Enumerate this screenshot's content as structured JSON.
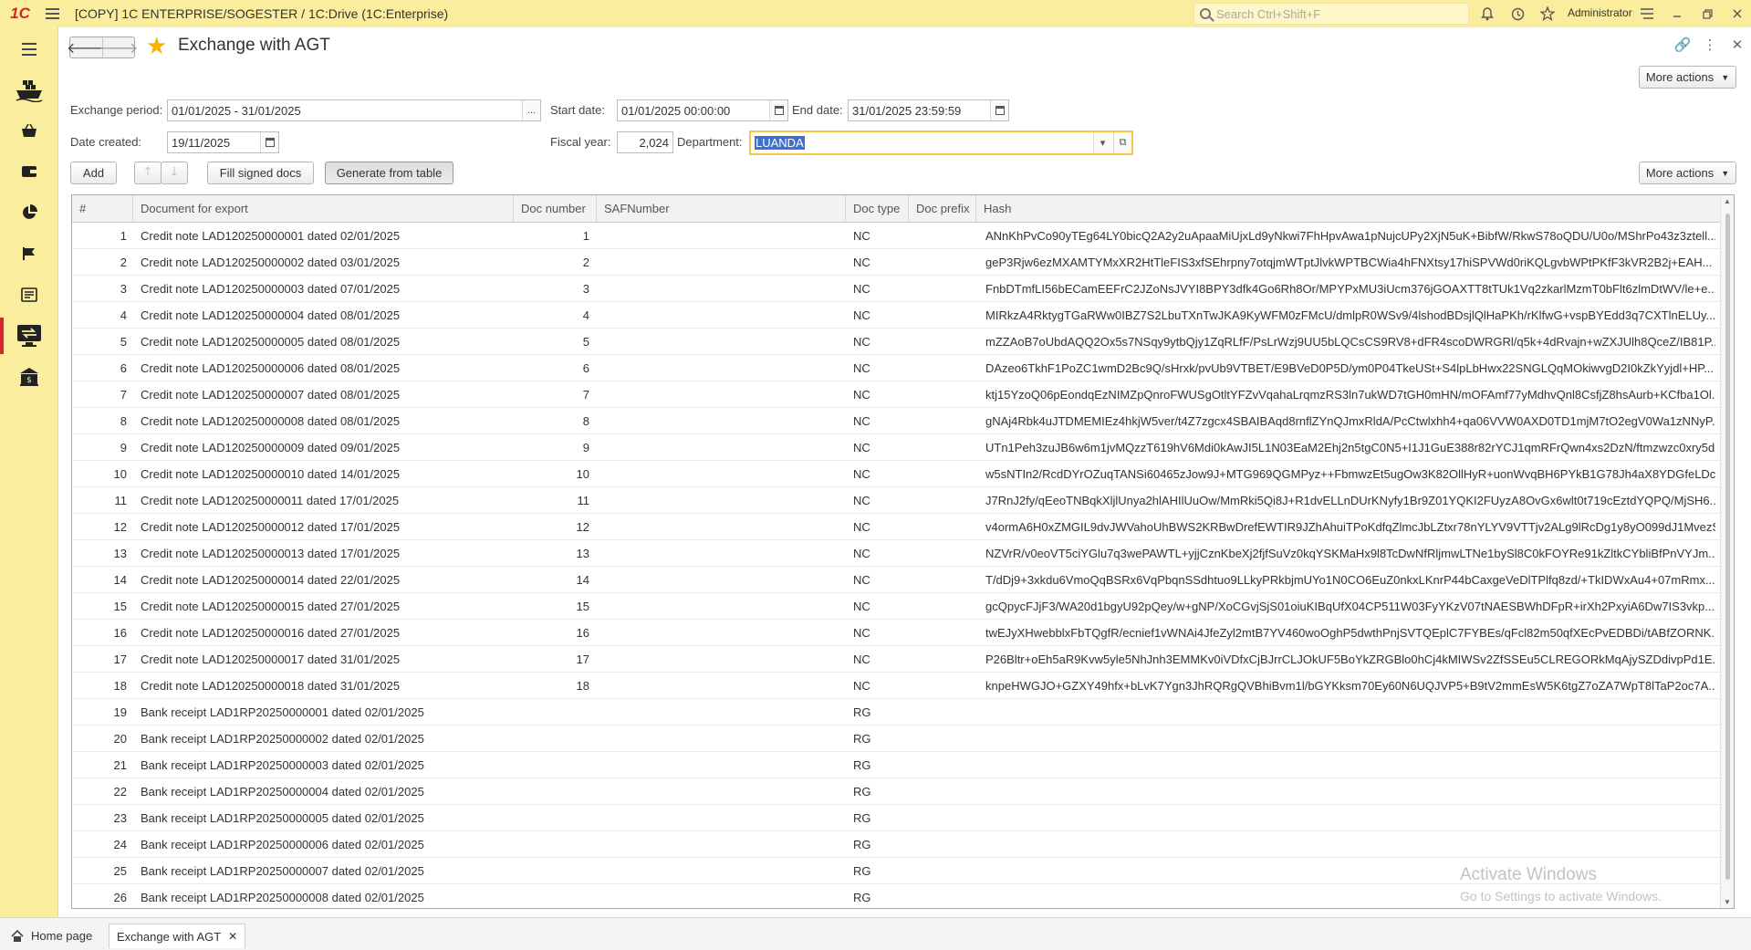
{
  "titlebar": {
    "logo": "1С",
    "title": "[COPY] 1C ENTERPRISE/SOGESTER / 1C:Drive  (1C:Enterprise)",
    "search_placeholder": "Search Ctrl+Shift+F",
    "user": "Administrator"
  },
  "form": {
    "title": "Exchange with AGT",
    "more_actions_top": "More actions",
    "more_actions_table": "More actions",
    "exchange_period_label": "Exchange period:",
    "exchange_period_value": "01/01/2025 - 31/01/2025",
    "start_date_label": "Start date:",
    "start_date_value": "01/01/2025 00:00:00",
    "end_date_label": "End date:",
    "end_date_value": "31/01/2025 23:59:59",
    "date_created_label": "Date created:",
    "date_created_value": "19/11/2025",
    "fiscal_year_label": "Fiscal year:",
    "fiscal_year_value": "2,024",
    "department_label": "Department:",
    "department_value": "LUANDA",
    "add_button": "Add",
    "fill_signed_button": "Fill signed docs",
    "generate_button": "Generate from table"
  },
  "table": {
    "columns": [
      "#",
      "Document for export",
      "Doc number",
      "SAFNumber",
      "Doc type",
      "Doc prefix",
      "Hash"
    ],
    "rows": [
      {
        "n": "1",
        "doc": "Credit note LAD120250000001 dated 02/01/2025",
        "docnum": "1",
        "saf": "",
        "type": "NC",
        "prefix": "",
        "hash": "ANnKhPvCo90yTEg64LY0bicQ2A2y2uApaaMiUjxLd9yNkwi7FhHpvAwa1pNujcUPy2XjN5uK+BibfW/RkwS78oQDU/U0o/MShrPo43z3ztell..."
      },
      {
        "n": "2",
        "doc": "Credit note LAD120250000002 dated 03/01/2025",
        "docnum": "2",
        "saf": "",
        "type": "NC",
        "prefix": "",
        "hash": "geP3Rjw6ezMXAMTYMxXR2HtTleFIS3xfSEhrpny7otqjmWTptJlvkWPTBCWia4hFNXtsy17hiSPVWd0riKQLgvbWPtPKfF3kVR2B2j+EAH..."
      },
      {
        "n": "3",
        "doc": "Credit note LAD120250000003 dated 07/01/2025",
        "docnum": "3",
        "saf": "",
        "type": "NC",
        "prefix": "",
        "hash": "FnbDTmfLI56bECamEEFrC2JZoNsJVYI8BPY3dfk4Go6Rh8Or/MPYPxMU3iUcm376jGOAXTT8tTUk1Vq2zkarlMzmT0bFlt6zlmDtWV/le+e..."
      },
      {
        "n": "4",
        "doc": "Credit note LAD120250000004 dated 08/01/2025",
        "docnum": "4",
        "saf": "",
        "type": "NC",
        "prefix": "",
        "hash": "MIRkzA4RktygTGaRWw0IBZ7S2LbuTXnTwJKA9KyWFM0zFMcU/dmlpR0WSv9/4lshodBDsjlQlHaPKh/rKlfwG+vspBYEdd3q7CXTlnELUy..."
      },
      {
        "n": "5",
        "doc": "Credit note LAD120250000005 dated 08/01/2025",
        "docnum": "5",
        "saf": "",
        "type": "NC",
        "prefix": "",
        "hash": "mZZAoB7oUbdAQQ2Ox5s7NSqy9ytbQjy1ZqRLfF/PsLrWzj9UU5bLQCsCS9RV8+dFR4scoDWRGRl/q5k+4dRvajn+wZXJUlh8QceZ/IB81P..."
      },
      {
        "n": "6",
        "doc": "Credit note LAD120250000006 dated 08/01/2025",
        "docnum": "6",
        "saf": "",
        "type": "NC",
        "prefix": "",
        "hash": "DAzeo6TkhF1PoZC1wmD2Bc9Q/sHrxk/pvUb9VTBET/E9BVeD0P5D/ym0P04TkeUSt+S4lpLbHwx22SNGLQqMOkiwvgD2I0kZkYyjdl+HP..."
      },
      {
        "n": "7",
        "doc": "Credit note LAD120250000007 dated 08/01/2025",
        "docnum": "7",
        "saf": "",
        "type": "NC",
        "prefix": "",
        "hash": "ktj15YzoQ06pEondqEzNIMZpQnroFWUSgOtltYFZvVqahaLrqmzRS3ln7ukWD7tGH0mHN/mOFAmf77yMdhvQnl8CsfjZ8hsAurb+KCfba1Ol..."
      },
      {
        "n": "8",
        "doc": "Credit note LAD120250000008 dated 08/01/2025",
        "docnum": "8",
        "saf": "",
        "type": "NC",
        "prefix": "",
        "hash": "gNAj4Rbk4uJTDMEMIEz4hkjW5ver/t4Z7zgcx4SBAIBAqd8rnflZYnQJmxRldA/PcCtwlxhh4+qa06VVW0AXD0TD1mjM7tO2egV0Wa1zNNyP..."
      },
      {
        "n": "9",
        "doc": "Credit note LAD120250000009 dated 09/01/2025",
        "docnum": "9",
        "saf": "",
        "type": "NC",
        "prefix": "",
        "hash": "UTn1Peh3zuJB6w6m1jvMQzzT619hV6Mdi0kAwJI5L1N03EaM2Ehj2n5tgC0N5+I1J1GuE388r82rYCJ1qmRFrQwn4xs2DzN/ftmzwzc0xry5d..."
      },
      {
        "n": "10",
        "doc": "Credit note LAD120250000010 dated 14/01/2025",
        "docnum": "10",
        "saf": "",
        "type": "NC",
        "prefix": "",
        "hash": "w5sNTIn2/RcdDYrOZuqTANSi60465zJow9J+MTG969QGMPyz++FbmwzEt5ugOw3K82OllHyR+uonWvqBH6PYkB1G78Jh4aX8YDGfeLDc..."
      },
      {
        "n": "11",
        "doc": "Credit note LAD120250000011 dated 17/01/2025",
        "docnum": "11",
        "saf": "",
        "type": "NC",
        "prefix": "",
        "hash": "J7RnJ2fy/qEeoTNBqkXljlUnya2hlAHIlUuOw/MmRki5Qi8J+R1dvELLnDUrKNyfy1Br9Z01YQKI2FUyzA8OvGx6wlt0t719cEztdYQPQ/MjSH6..."
      },
      {
        "n": "12",
        "doc": "Credit note LAD120250000012 dated 17/01/2025",
        "docnum": "12",
        "saf": "",
        "type": "NC",
        "prefix": "",
        "hash": "v4ormA6H0xZMGIL9dvJWVahoUhBWS2KRBwDrefEWTIR9JZhAhuiTPoKdfqZlmcJbLZtxr78nYLYV9VTTjv2ALg9lRcDg1y8yO099dJ1MvezS..."
      },
      {
        "n": "13",
        "doc": "Credit note LAD120250000013 dated 17/01/2025",
        "docnum": "13",
        "saf": "",
        "type": "NC",
        "prefix": "",
        "hash": "NZVrR/v0eoVT5ciYGlu7q3wePAWTL+yjjCznKbeXj2fjfSuVz0kqYSKMaHx9l8TcDwNfRljmwLTNe1bySl8C0kFOYRe91kZltkCYbliBfPnVYJm..."
      },
      {
        "n": "14",
        "doc": "Credit note LAD120250000014 dated 22/01/2025",
        "docnum": "14",
        "saf": "",
        "type": "NC",
        "prefix": "",
        "hash": "T/dDj9+3xkdu6VmoQqBSRx6VqPbqnSSdhtuo9LLkyPRkbjmUYo1N0CO6EuZ0nkxLKnrP44bCaxgeVeDlTPlfq8zd/+TkIDWxAu4+07mRmx..."
      },
      {
        "n": "15",
        "doc": "Credit note LAD120250000015 dated 27/01/2025",
        "docnum": "15",
        "saf": "",
        "type": "NC",
        "prefix": "",
        "hash": "gcQpycFJjF3/WA20d1bgyU92pQey/w+gNP/XoCGvjSjS01oiuKIBqUfX04CP511W03FyYKzV07tNAESBWhDFpR+irXh2PxyiA6Dw7IS3vkp..."
      },
      {
        "n": "16",
        "doc": "Credit note LAD120250000016 dated 27/01/2025",
        "docnum": "16",
        "saf": "",
        "type": "NC",
        "prefix": "",
        "hash": "twEJyXHwebblxFbTQgfR/ecnief1vWNAi4JfeZyl2mtB7YV460woOghP5dwthPnjSVTQEplC7FYBEs/qFcl82m50qfXEcPvEDBDi/tABfZORNK..."
      },
      {
        "n": "17",
        "doc": "Credit note LAD120250000017 dated 31/01/2025",
        "docnum": "17",
        "saf": "",
        "type": "NC",
        "prefix": "",
        "hash": "P26Bltr+oEh5aR9Kvw5yle5NhJnh3EMMKv0iVDfxCjBJrrCLJOkUF5BoYkZRGBlo0hCj4kMIWSv2ZfSSEu5CLREGORkMqAjySZDdivpPd1E..."
      },
      {
        "n": "18",
        "doc": "Credit note LAD120250000018 dated 31/01/2025",
        "docnum": "18",
        "saf": "",
        "type": "NC",
        "prefix": "",
        "hash": "knpeHWGJO+GZXY49hfx+bLvK7Ygn3JhRQRgQVBhiBvm1l/bGYKksm70Ey60N6UQJVP5+B9tV2mmEsW5K6tgZ7oZA7WpT8lTaP2oc7A..."
      },
      {
        "n": "19",
        "doc": "Bank receipt LAD1RP20250000001 dated 02/01/2025",
        "docnum": "",
        "saf": "",
        "type": "RG",
        "prefix": "",
        "hash": ""
      },
      {
        "n": "20",
        "doc": "Bank receipt LAD1RP20250000002 dated 02/01/2025",
        "docnum": "",
        "saf": "",
        "type": "RG",
        "prefix": "",
        "hash": ""
      },
      {
        "n": "21",
        "doc": "Bank receipt LAD1RP20250000003 dated 02/01/2025",
        "docnum": "",
        "saf": "",
        "type": "RG",
        "prefix": "",
        "hash": ""
      },
      {
        "n": "22",
        "doc": "Bank receipt LAD1RP20250000004 dated 02/01/2025",
        "docnum": "",
        "saf": "",
        "type": "RG",
        "prefix": "",
        "hash": ""
      },
      {
        "n": "23",
        "doc": "Bank receipt LAD1RP20250000005 dated 02/01/2025",
        "docnum": "",
        "saf": "",
        "type": "RG",
        "prefix": "",
        "hash": ""
      },
      {
        "n": "24",
        "doc": "Bank receipt LAD1RP20250000006 dated 02/01/2025",
        "docnum": "",
        "saf": "",
        "type": "RG",
        "prefix": "",
        "hash": ""
      },
      {
        "n": "25",
        "doc": "Bank receipt LAD1RP20250000007 dated 02/01/2025",
        "docnum": "",
        "saf": "",
        "type": "RG",
        "prefix": "",
        "hash": ""
      },
      {
        "n": "26",
        "doc": "Bank receipt LAD1RP20250000008 dated 02/01/2025",
        "docnum": "",
        "saf": "",
        "type": "RG",
        "prefix": "",
        "hash": ""
      }
    ]
  },
  "watermark": {
    "line1": "Activate Windows",
    "line2": "Go to Settings to activate Windows."
  },
  "bottom_tabs": {
    "home": "Home page",
    "current": "Exchange with AGT"
  },
  "colors": {
    "panel": "#fbed9e",
    "brand": "#d4262c",
    "focus": "#f6c742",
    "selection": "#3f6fd0"
  }
}
